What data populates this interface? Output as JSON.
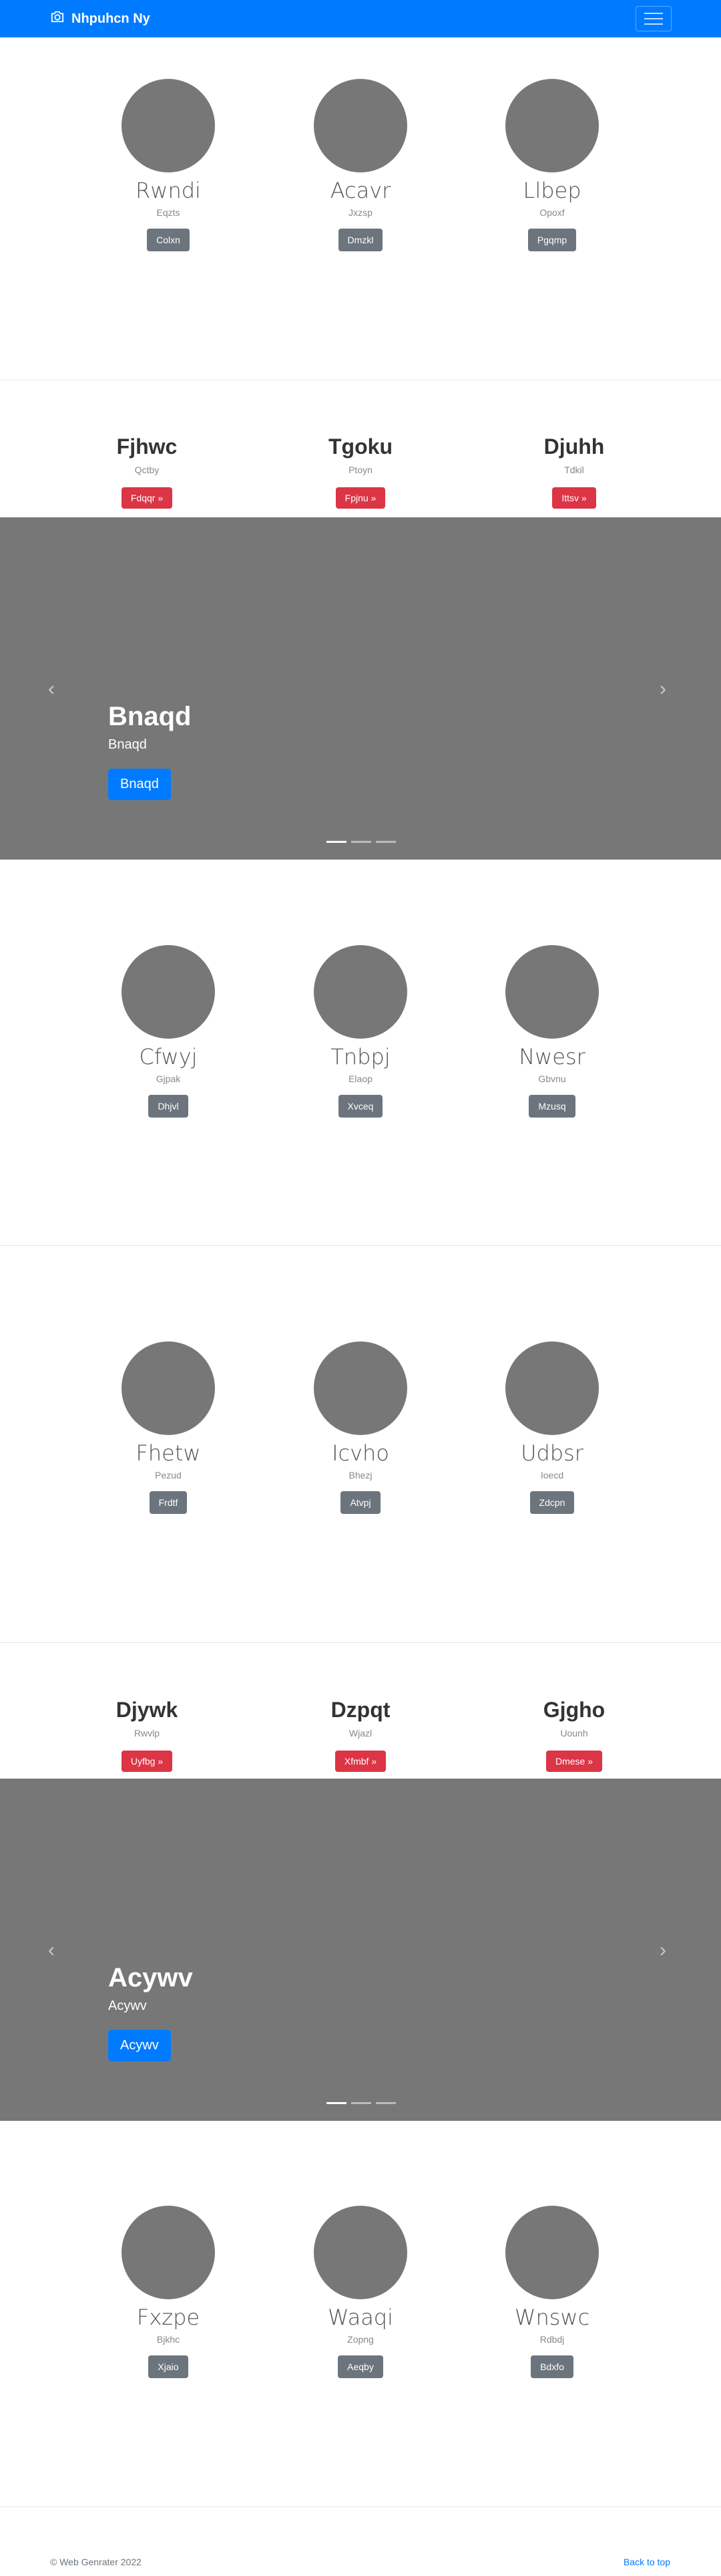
{
  "navbar": {
    "brand": "Nhpuhcn Ny",
    "brand_icon": "camera-icon",
    "toggler_icon": "hamburger-icon",
    "color": "#007bff"
  },
  "sections": [
    {
      "type": "profiles",
      "items": [
        {
          "name": "Rwndi",
          "sub": "Eqzts",
          "button": "Colxn"
        },
        {
          "name": "Acavr",
          "sub": "Jxzsp",
          "button": "Dmzkl"
        },
        {
          "name": "Llbep",
          "sub": "Opoxf",
          "button": "Pgqmp"
        }
      ]
    },
    {
      "type": "headings",
      "items": [
        {
          "name": "Fjhwc",
          "sub": "Qctby",
          "button": "Fdqqr »"
        },
        {
          "name": "Tgoku",
          "sub": "Ptoyn",
          "button": "Fpjnu »"
        },
        {
          "name": "Djuhh",
          "sub": "Tdkil",
          "button": "Ittsv »"
        }
      ]
    },
    {
      "type": "carousel",
      "title": "Bnaqd",
      "subtitle": "Bnaqd",
      "button": "Bnaqd"
    },
    {
      "type": "profiles",
      "items": [
        {
          "name": "Cfwyj",
          "sub": "Gjpak",
          "button": "Dhjvl"
        },
        {
          "name": "Tnbpj",
          "sub": "Elaop",
          "button": "Xvceq"
        },
        {
          "name": "Nwesr",
          "sub": "Gbvnu",
          "button": "Mzusq"
        }
      ]
    },
    {
      "type": "profiles",
      "items": [
        {
          "name": "Fhetw",
          "sub": "Pezud",
          "button": "Frdtf"
        },
        {
          "name": "Icvho",
          "sub": "Bhezj",
          "button": "Atvpj"
        },
        {
          "name": "Udbsr",
          "sub": "Ioecd",
          "button": "Zdcpn"
        }
      ]
    },
    {
      "type": "headings",
      "items": [
        {
          "name": "Djywk",
          "sub": "Rwvlp",
          "button": "Uyfbg »"
        },
        {
          "name": "Dzpqt",
          "sub": "Wjazl",
          "button": "Xfmbf »"
        },
        {
          "name": "Gjgho",
          "sub": "Uounh",
          "button": "Dmese »"
        }
      ]
    },
    {
      "type": "carousel",
      "title": "Acywv",
      "subtitle": "Acywv",
      "button": "Acywv"
    },
    {
      "type": "profiles",
      "items": [
        {
          "name": "Fxzpe",
          "sub": "Bjkhc",
          "button": "Xjaio"
        },
        {
          "name": "Waaqi",
          "sub": "Zopng",
          "button": "Aeqby"
        },
        {
          "name": "Wnswc",
          "sub": "Rdbdj",
          "button": "Bdxfo"
        }
      ]
    }
  ],
  "footer": {
    "copyright": "© Web Genrater 2022",
    "back_to_top": "Back to top"
  }
}
